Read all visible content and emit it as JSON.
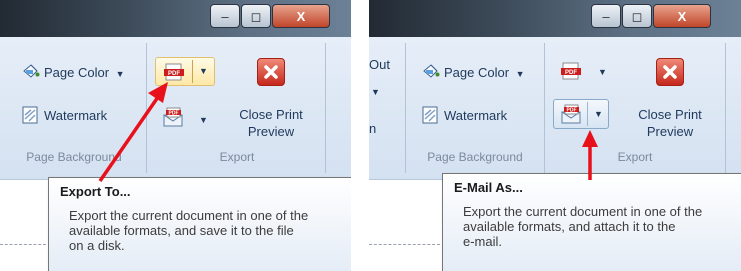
{
  "left": {
    "page_color_label": "Page Color",
    "watermark_label": "Watermark",
    "close_print_preview_label": "Close Print\nPreview",
    "group_page_background": "Page Background",
    "group_export": "Export",
    "tooltip": {
      "title": "Export To...",
      "description": "Export the current document in one of the\navailable formats, and save it to the file\non a disk."
    },
    "icons": {
      "page_color": "paint-bucket-icon",
      "watermark": "watermark-icon",
      "export_to": "pdf-file-icon",
      "email_as": "email-pdf-icon",
      "close": "close-x-icon",
      "arrow": "annotation-arrow"
    }
  },
  "right": {
    "partial_out_label": "Out",
    "partial_n_label": "n",
    "page_color_label": "Page Color",
    "watermark_label": "Watermark",
    "close_print_preview_label": "Close Print\nPreview",
    "group_page_background": "Page Background",
    "group_export": "Export",
    "tooltip": {
      "title": "E-Mail As...",
      "description": "Export the current document in one of the\navailable formats, and attach it to the\ne-mail."
    }
  },
  "colors": {
    "annotation_arrow": "#e8101a",
    "close_button": "#d6342a",
    "ribbon_background": "#dbe6f4",
    "titlebar": "#3c4a58"
  }
}
